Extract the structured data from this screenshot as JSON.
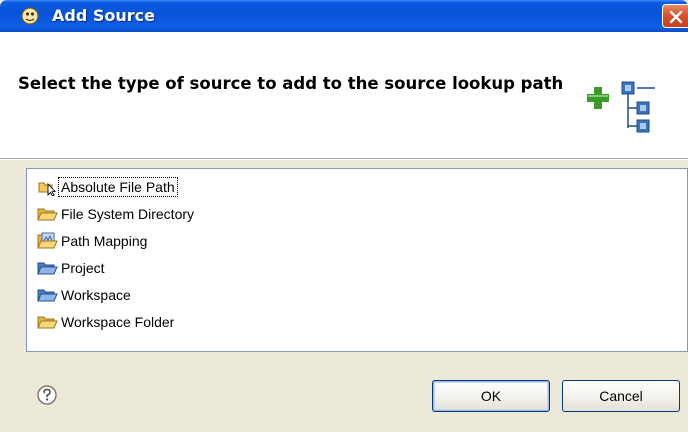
{
  "window": {
    "title": "Add Source"
  },
  "banner": {
    "heading": "Select the type of source to add to the source lookup path"
  },
  "source_types": [
    {
      "label": "Absolute File Path",
      "icon": "absolute-file-path-icon",
      "selected": true
    },
    {
      "label": "File System Directory",
      "icon": "folder-icon",
      "selected": false
    },
    {
      "label": "Path Mapping",
      "icon": "path-mapping-icon",
      "selected": false
    },
    {
      "label": "Project",
      "icon": "project-folder-icon",
      "selected": false
    },
    {
      "label": "Workspace",
      "icon": "workspace-folder-icon",
      "selected": false
    },
    {
      "label": "Workspace Folder",
      "icon": "folder-icon",
      "selected": false
    }
  ],
  "buttons": {
    "ok": "OK",
    "cancel": "Cancel"
  },
  "colors": {
    "titlebar": "#0853d8",
    "close": "#d9532c",
    "folder": "#f2c85b",
    "accent_green": "#3a9a2a",
    "accent_blue": "#3b74b8"
  }
}
